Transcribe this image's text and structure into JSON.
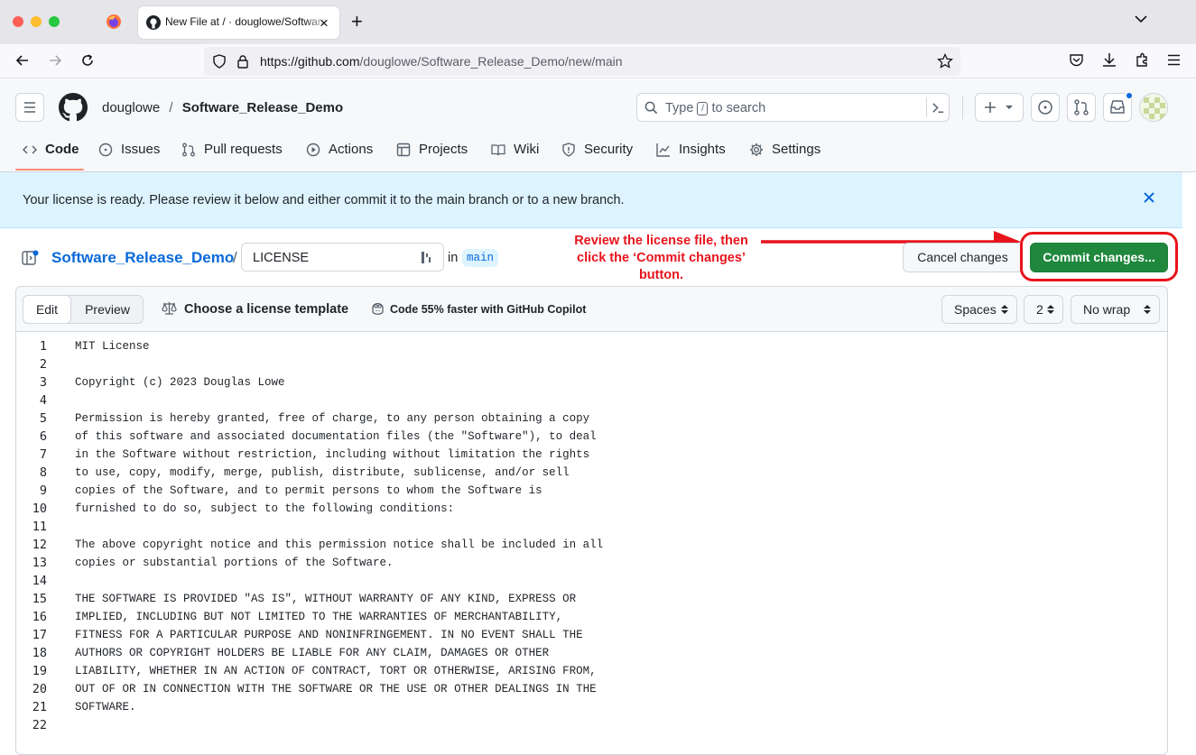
{
  "browser": {
    "tab_title": "New File at / · douglowe/Software_Release_Demo",
    "url_host": "https://github.com",
    "url_path": "/douglowe/Software_Release_Demo/new/main"
  },
  "header": {
    "owner": "douglowe",
    "separator": "/",
    "repo": "Software_Release_Demo",
    "search_prefix": "Type",
    "search_key": "/",
    "search_suffix": "to search"
  },
  "nav": {
    "tabs": [
      {
        "label": "Code",
        "icon": "code-icon"
      },
      {
        "label": "Issues",
        "icon": "issue-icon"
      },
      {
        "label": "Pull requests",
        "icon": "pull-request-icon"
      },
      {
        "label": "Actions",
        "icon": "play-icon"
      },
      {
        "label": "Projects",
        "icon": "table-icon"
      },
      {
        "label": "Wiki",
        "icon": "book-icon"
      },
      {
        "label": "Security",
        "icon": "shield-icon"
      },
      {
        "label": "Insights",
        "icon": "graph-icon"
      },
      {
        "label": "Settings",
        "icon": "gear-icon"
      }
    ]
  },
  "flash": {
    "message": "Your license is ready. Please review it below and either commit it to the main branch or to a new branch."
  },
  "editor_header": {
    "repo_link": "Software_Release_Demo",
    "separator": "/",
    "filename": "LICENSE",
    "in_label": "in",
    "branch": "main",
    "cancel_label": "Cancel changes",
    "commit_label": "Commit changes..."
  },
  "annotation": {
    "text_1": "Review the license file, then",
    "text_2": "click the ‘Commit changes’",
    "text_3": "button.",
    "color": "#e8141c"
  },
  "editor_bar": {
    "edit_tab": "Edit",
    "preview_tab": "Preview",
    "template_label": "Choose a license template",
    "copilot_label": "Code 55% faster with GitHub Copilot",
    "indent_mode": "Spaces",
    "indent_size": "2",
    "wrap_mode": "No wrap"
  },
  "code_lines": [
    "MIT License",
    "",
    "Copyright (c) 2023 Douglas Lowe",
    "",
    "Permission is hereby granted, free of charge, to any person obtaining a copy",
    "of this software and associated documentation files (the \"Software\"), to deal",
    "in the Software without restriction, including without limitation the rights",
    "to use, copy, modify, merge, publish, distribute, sublicense, and/or sell",
    "copies of the Software, and to permit persons to whom the Software is",
    "furnished to do so, subject to the following conditions:",
    "",
    "The above copyright notice and this permission notice shall be included in all",
    "copies or substantial portions of the Software.",
    "",
    "THE SOFTWARE IS PROVIDED \"AS IS\", WITHOUT WARRANTY OF ANY KIND, EXPRESS OR",
    "IMPLIED, INCLUDING BUT NOT LIMITED TO THE WARRANTIES OF MERCHANTABILITY,",
    "FITNESS FOR A PARTICULAR PURPOSE AND NONINFRINGEMENT. IN NO EVENT SHALL THE",
    "AUTHORS OR COPYRIGHT HOLDERS BE LIABLE FOR ANY CLAIM, DAMAGES OR OTHER",
    "LIABILITY, WHETHER IN AN ACTION OF CONTRACT, TORT OR OTHERWISE, ARISING FROM,",
    "OUT OF OR IN CONNECTION WITH THE SOFTWARE OR THE USE OR OTHER DEALINGS IN THE",
    "SOFTWARE.",
    ""
  ],
  "colors": {
    "commit_green": "#1f883d",
    "link_blue": "#0969da",
    "flash_bg": "#ddf4ff"
  }
}
